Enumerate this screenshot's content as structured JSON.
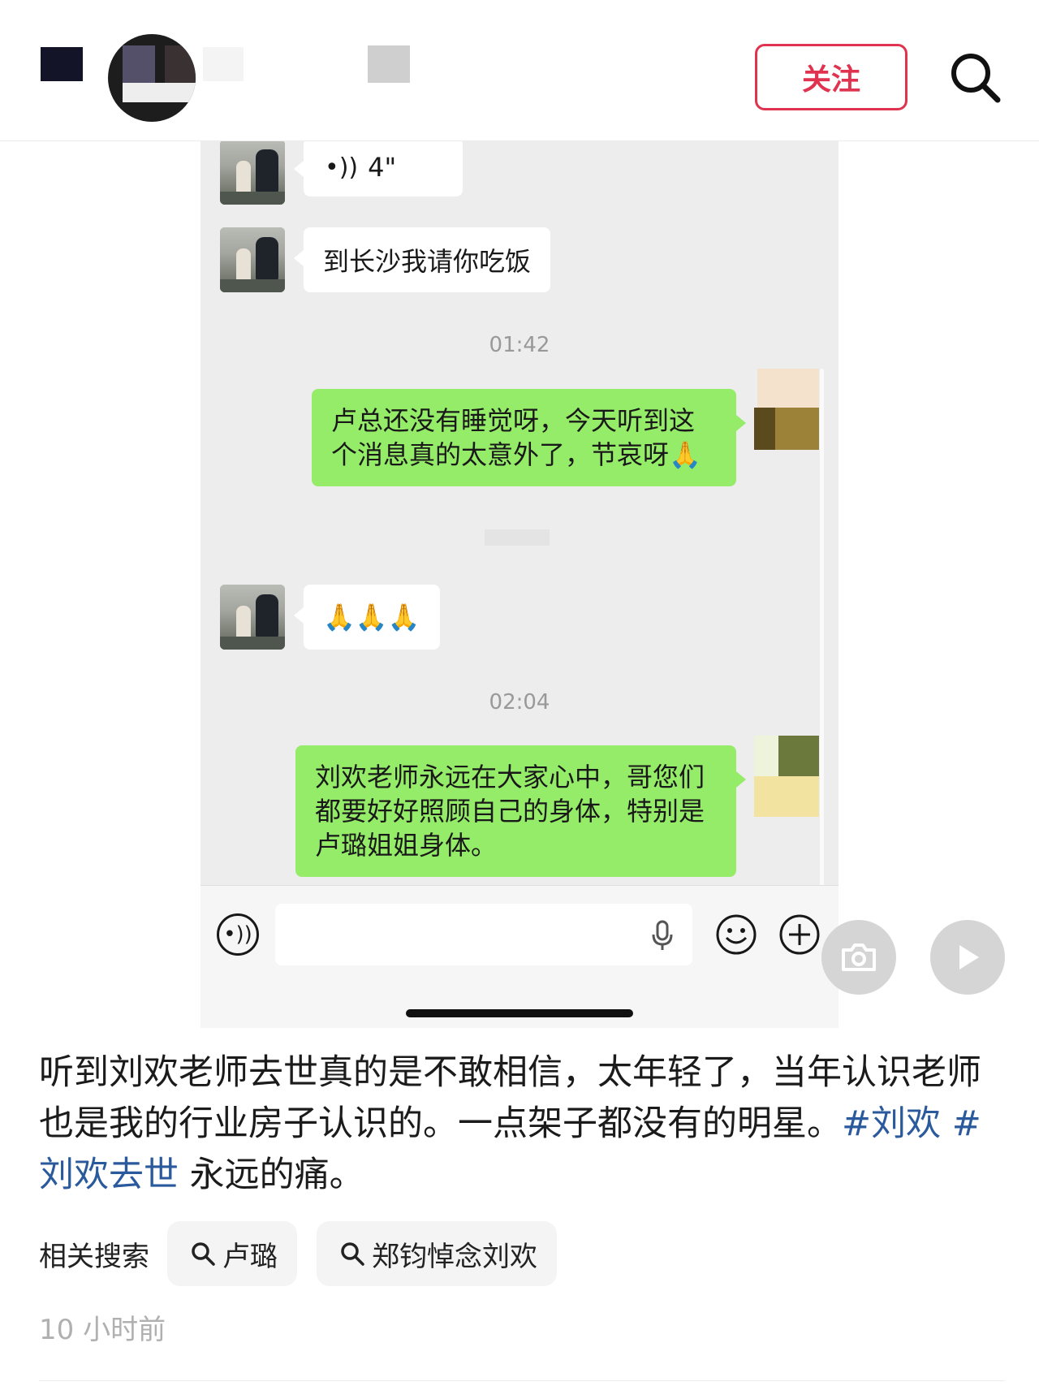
{
  "header": {
    "follow_label": "关注"
  },
  "chat": {
    "voice_duration": "4\"",
    "msg_1": "到长沙我请你吃饭",
    "time_1": "01:42",
    "msg_2": "卢总还没有睡觉呀，今天听到这个消息真的太意外了，节哀呀🙏",
    "msg_3": "🙏🙏🙏",
    "time_2": "02:04",
    "msg_4": "刘欢老师永远在大家心中，哥您们都要好好照顾自己的身体，特别是卢璐姐姐身体。"
  },
  "caption": {
    "text": "听到刘欢老师去世真的是不敢相信，太年轻了，当年认识老师也是我的行业房子认识的。一点架子都没有的明星。",
    "tag_1": "#刘欢",
    "tag_2": "#刘欢去世",
    "tail": "永远的痛。"
  },
  "related": {
    "label": "相关搜索",
    "items": [
      "卢璐",
      "郑钧悼念刘欢"
    ]
  },
  "meta": {
    "time_ago": "10 小时前"
  },
  "colors": {
    "follow_red": "#e0334f",
    "hashtag_blue": "#2a5a9c",
    "wechat_green": "#95ec69"
  }
}
